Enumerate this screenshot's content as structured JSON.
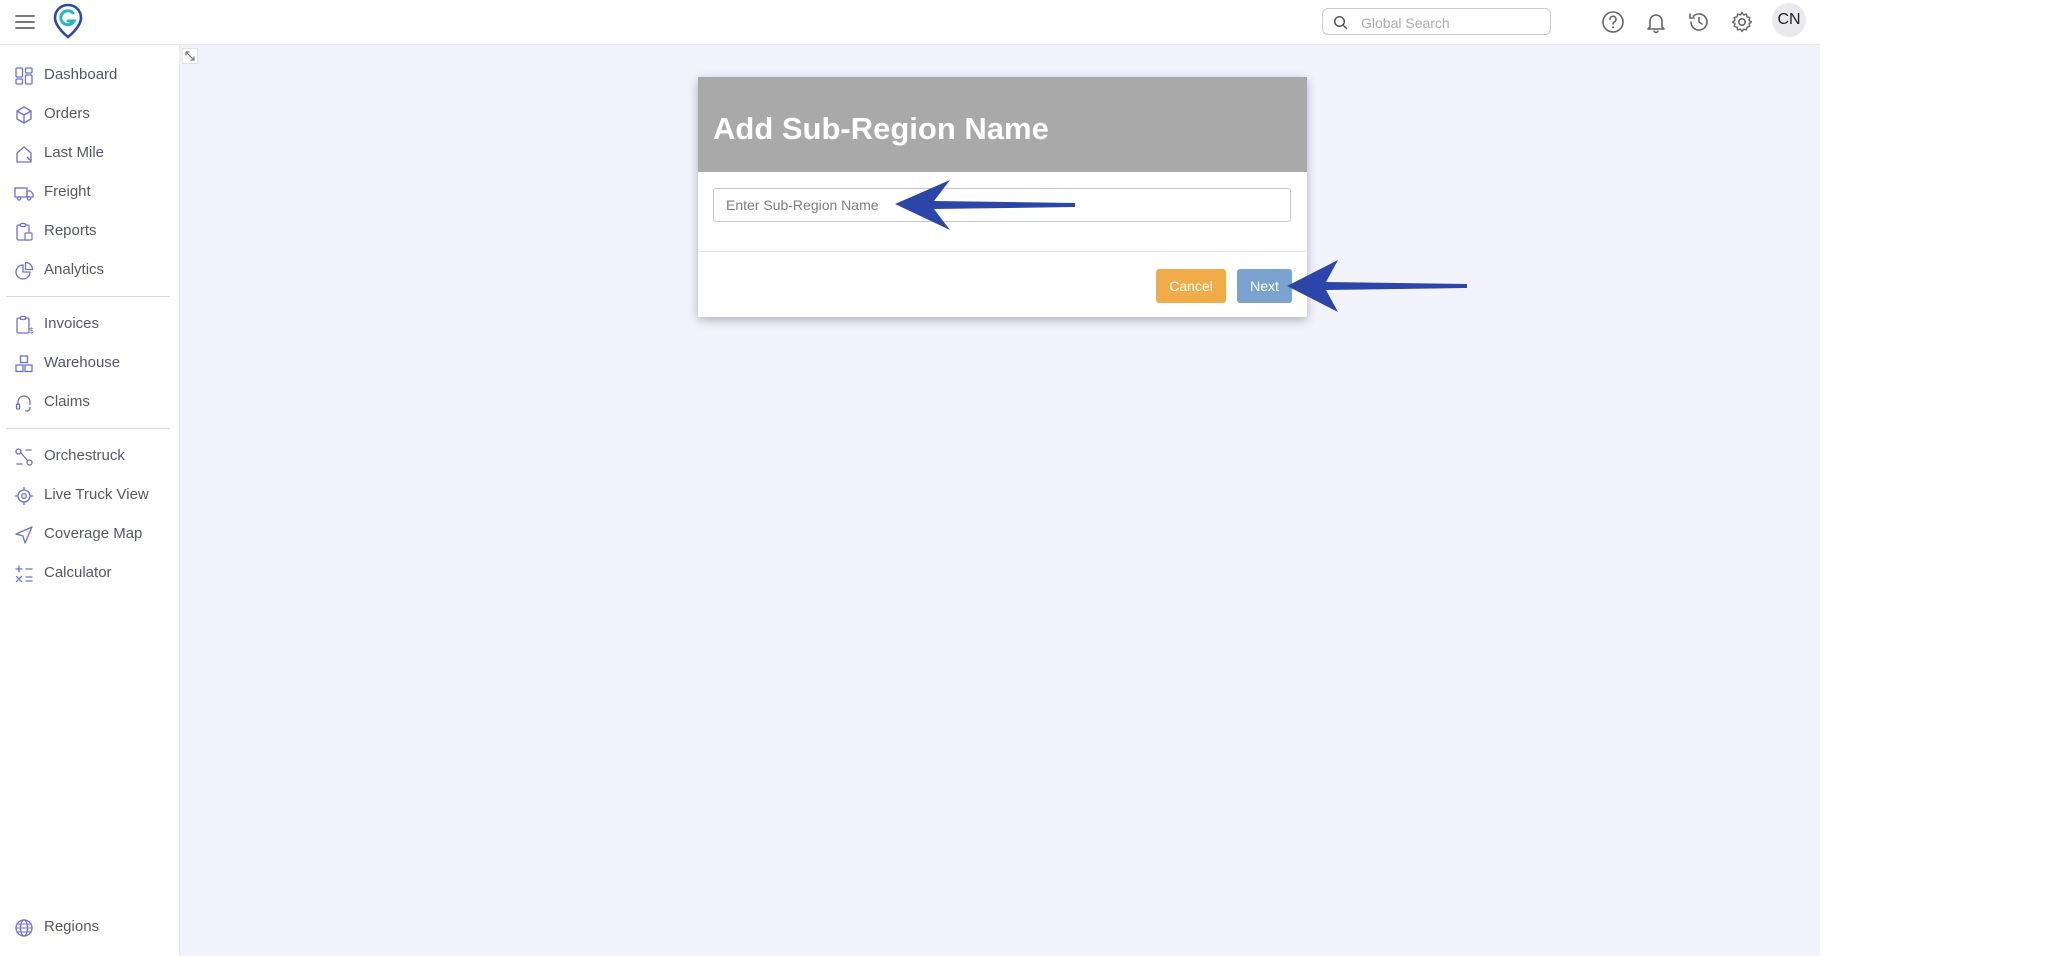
{
  "topbar": {
    "search_placeholder": "Global Search",
    "avatar_initials": "CN"
  },
  "sidebar": {
    "groups": [
      [
        {
          "label": "Dashboard",
          "icon": "dashboard-icon"
        },
        {
          "label": "Orders",
          "icon": "box-icon"
        },
        {
          "label": "Last Mile",
          "icon": "house-icon"
        },
        {
          "label": "Freight",
          "icon": "truck-icon"
        },
        {
          "label": "Reports",
          "icon": "clipboard-icon"
        },
        {
          "label": "Analytics",
          "icon": "pie-chart-icon"
        }
      ],
      [
        {
          "label": "Invoices",
          "icon": "invoice-icon"
        },
        {
          "label": "Warehouse",
          "icon": "boxes-icon"
        },
        {
          "label": "Claims",
          "icon": "headset-icon"
        }
      ],
      [
        {
          "label": "Orchestruck",
          "icon": "route-icon"
        },
        {
          "label": "Live Truck View",
          "icon": "target-icon"
        },
        {
          "label": "Coverage Map",
          "icon": "navigation-icon"
        },
        {
          "label": "Calculator",
          "icon": "calculator-icon"
        }
      ]
    ],
    "bottom_item": {
      "label": "Regions",
      "icon": "globe-icon"
    }
  },
  "modal": {
    "title": "Add Sub-Region Name",
    "input_placeholder": "Enter Sub-Region Name",
    "input_value": "",
    "cancel_label": "Cancel",
    "next_label": "Next"
  },
  "colors": {
    "accent_icon": "#6b6fd6",
    "content_bg": "#f2f3fc",
    "modal_header": "#a9a9a9",
    "cancel_button": "#efac48",
    "next_button": "#7aa3cf",
    "annotation_arrow": "#2c45a8"
  }
}
